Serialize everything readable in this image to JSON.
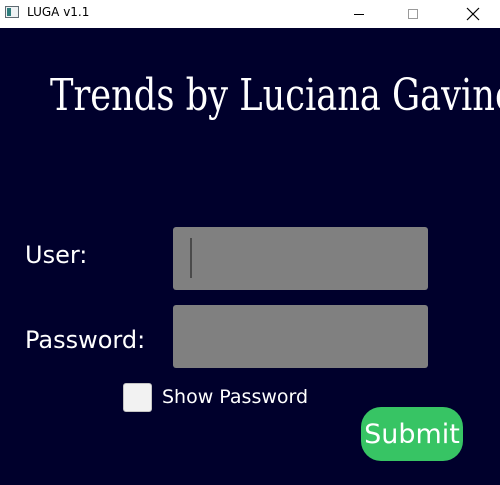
{
  "window": {
    "title": "LUGA v1.1",
    "icon": "app-window-icon",
    "controls": {
      "minimize_icon": "minimize-icon",
      "maximize_icon": "maximize-icon",
      "close_icon": "close-icon",
      "close_glyph": "✕"
    }
  },
  "heading": "Trends by Luciana Gavino",
  "form": {
    "user_label": "User:",
    "user_value": "",
    "password_label": "Password:",
    "password_value": "",
    "show_password_label": "Show Password",
    "show_password_checked": false,
    "submit_label": "Submit"
  },
  "colors": {
    "background": "#00002c",
    "field": "#808080",
    "submit": "#37c464",
    "text": "#ffffff"
  }
}
